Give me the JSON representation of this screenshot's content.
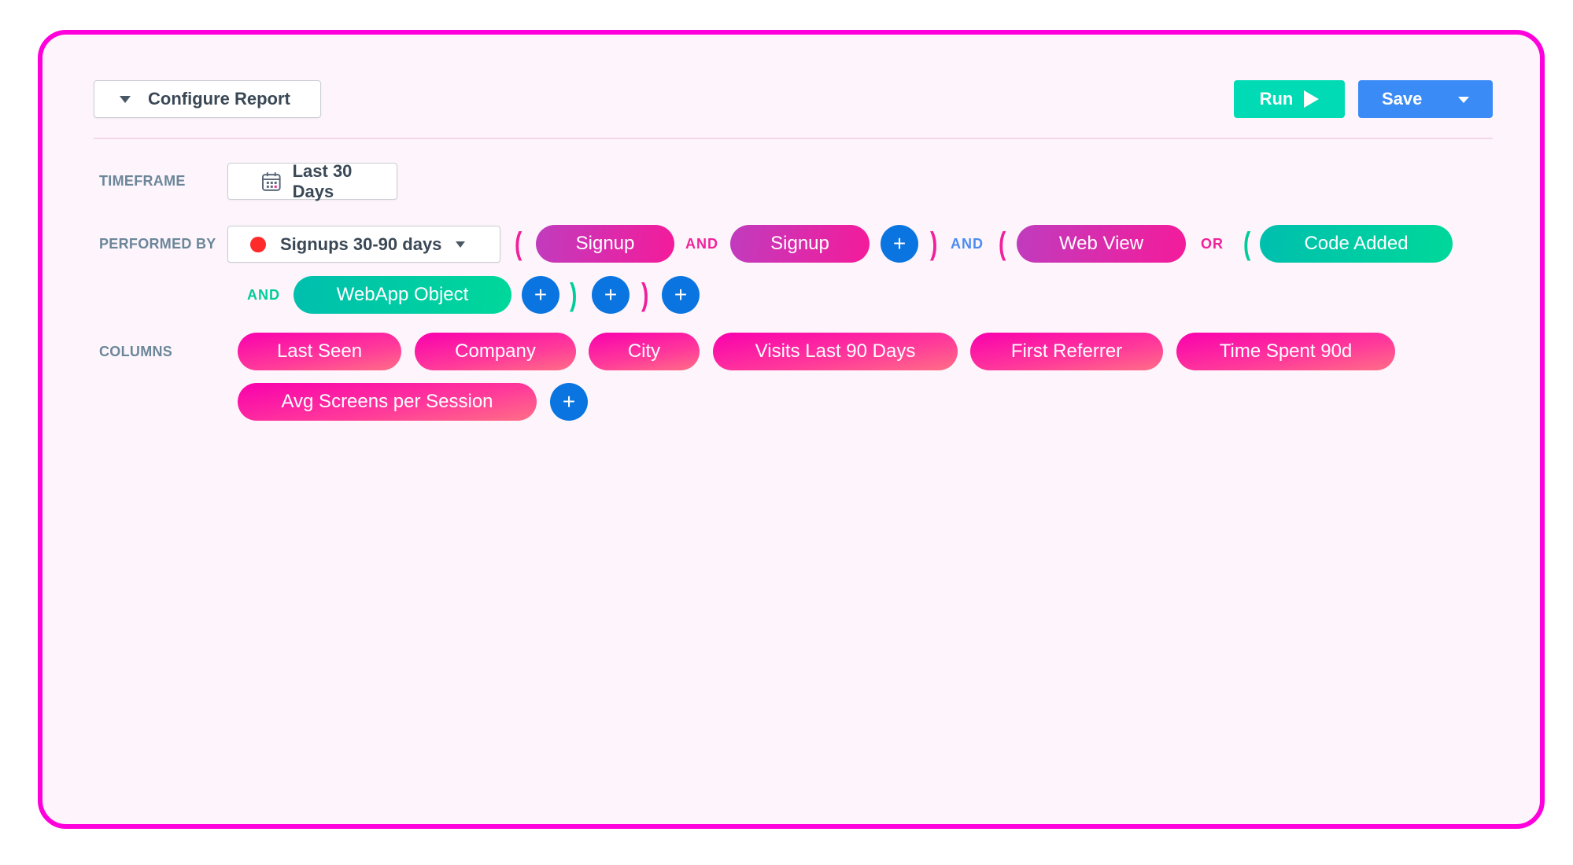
{
  "colors": {
    "frame_border": "#ff00dc",
    "background": "#fdf5fb",
    "run": "#00dbb5",
    "save": "#3b8bf6",
    "plus": "#0a74e0",
    "pink_operator": "#f0219a",
    "blue_operator": "#4a8cf0",
    "teal_operator": "#00cc9a",
    "segment_dot": "#ff2a2a"
  },
  "header": {
    "configure_label": "Configure Report",
    "run_label": "Run",
    "save_label": "Save"
  },
  "timeframe": {
    "label": "TIMEFRAME",
    "value": "Last 30 Days"
  },
  "performed_by": {
    "label": "PERFORMED BY",
    "segment": "Signups 30-90 days",
    "tokens": {
      "paren_open_1": "(",
      "event_1": "Signup",
      "op_1": "AND",
      "event_2": "Signup",
      "plus": "+",
      "paren_close_1": ")",
      "op_2": "AND",
      "paren_open_2": "(",
      "event_3": "Web View",
      "op_3": "OR",
      "paren_open_3": "(",
      "event_4": "Code Added",
      "op_4": "AND",
      "event_5": "WebApp Object",
      "paren_close_3": ")",
      "paren_close_2": ")"
    }
  },
  "columns": {
    "label": "COLUMNS",
    "items": [
      "Last Seen",
      "Company",
      "City",
      "Visits Last 90 Days",
      "First Referrer",
      "Time Spent 90d",
      "Avg Screens per Session"
    ],
    "add": "+"
  }
}
